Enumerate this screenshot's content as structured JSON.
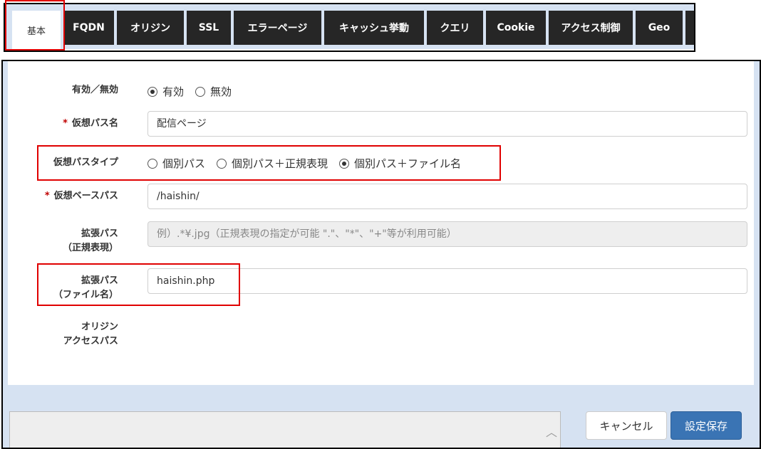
{
  "tabs": [
    {
      "label": "基本",
      "active": true
    },
    {
      "label": "FQDN"
    },
    {
      "label": "オリジン"
    },
    {
      "label": "SSL"
    },
    {
      "label": "エラーページ"
    },
    {
      "label": "キャッシュ挙動"
    },
    {
      "label": "クエリ"
    },
    {
      "label": "Cookie"
    },
    {
      "label": "アクセス制御"
    },
    {
      "label": "Geo"
    }
  ],
  "form": {
    "enabled": {
      "label": "有効／無効",
      "options": [
        "有効",
        "無効"
      ],
      "selected": "有効"
    },
    "virtual_path_name": {
      "required_mark": "*",
      "label": "仮想パス名",
      "value": "配信ページ"
    },
    "virtual_path_type": {
      "label": "仮想パスタイプ",
      "options": [
        "個別パス",
        "個別パス＋正規表現",
        "個別パス＋ファイル名"
      ],
      "selected": "個別パス＋ファイル名"
    },
    "virtual_base_path": {
      "required_mark": "*",
      "label": "仮想ベースパス",
      "value": "/haishin/"
    },
    "ext_path_regex": {
      "label_line1": "拡張パス",
      "label_line2": "（正規表現）",
      "placeholder": "例）.*¥.jpg（正規表現の指定が可能 \".\"、\"*\"、\"+\"等が利用可能）"
    },
    "ext_path_filename": {
      "label_line1": "拡張パス",
      "label_line2": "（ファイル名）",
      "value": "haishin.php"
    },
    "origin_access_path": {
      "label_line1": "オリジン",
      "label_line2": "アクセスパス"
    }
  },
  "footer": {
    "cancel_label": "キャンセル",
    "save_label": "設定保存"
  }
}
